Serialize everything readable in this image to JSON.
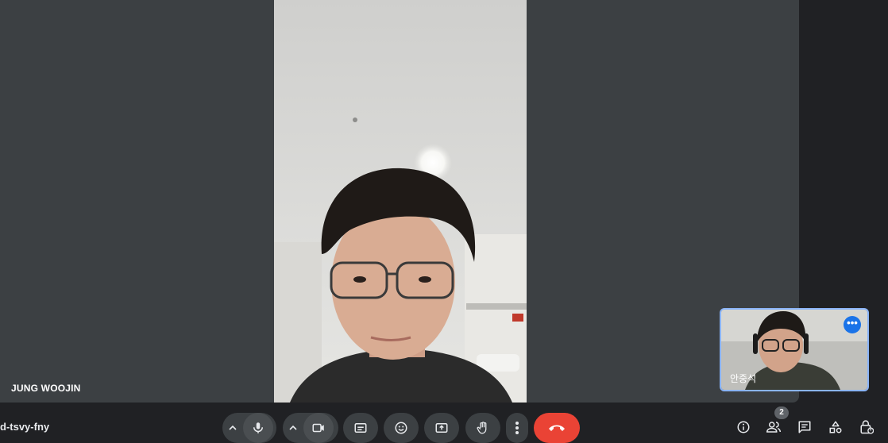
{
  "main_participant": {
    "name": "JUNG WOOJIN"
  },
  "self_view": {
    "name": "안중석",
    "more_options_glyph": "•••"
  },
  "meeting": {
    "code": "d-tsvy-fny"
  },
  "controls": {
    "mic_options": "chevron-up-icon",
    "mic": "microphone-icon",
    "camera_options": "chevron-up-icon",
    "camera": "camera-icon",
    "captions": "closed-captions-icon",
    "reactions": "emoji-icon",
    "present": "present-screen-icon",
    "raise_hand": "hand-icon",
    "more": "more-vert-icon",
    "leave": "end-call-icon"
  },
  "right_panel": {
    "info": "info-icon",
    "people": "people-icon",
    "people_count": "2",
    "chat": "chat-icon",
    "activities": "activities-icon",
    "host_controls": "lock-person-icon"
  },
  "colors": {
    "background": "#202124",
    "tile": "#3c4043",
    "end_call": "#ea4335",
    "accent": "#8ab4f8",
    "badge_blue": "#1a73e8"
  }
}
